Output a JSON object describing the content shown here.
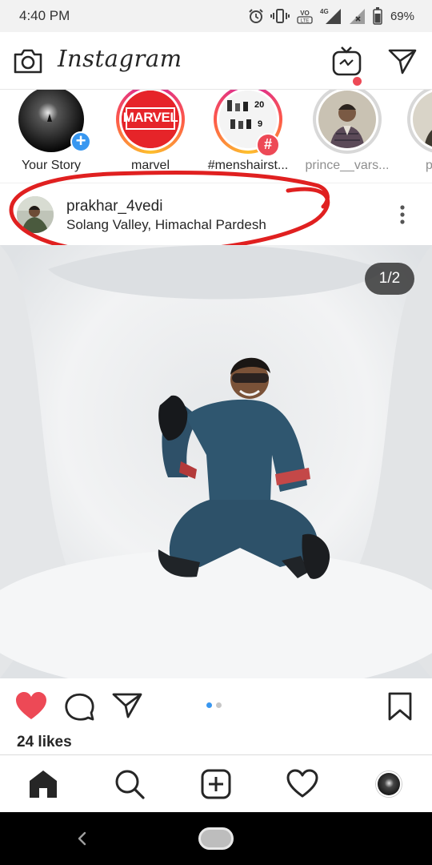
{
  "status_bar": {
    "time": "4:40 PM",
    "battery": "69%",
    "network_label": "4G",
    "volte_label": "VoLTE",
    "icons": [
      "alarm-icon",
      "vibrate-icon",
      "volte-icon",
      "signal-4g-icon",
      "signal-no-service-icon",
      "battery-icon"
    ]
  },
  "header": {
    "brand": "Instagram",
    "camera_icon": "camera-icon",
    "igtv_icon": "igtv-icon",
    "direct_icon": "direct-message-icon",
    "notification_color": "#ed4956"
  },
  "stories": [
    {
      "label": "Your Story",
      "ring": "none",
      "badge": "+"
    },
    {
      "label": "marvel",
      "ring": "gradient",
      "image_text": "MARVEL"
    },
    {
      "label": "#menshairst...",
      "ring": "gradient",
      "badge": "#",
      "image_text_1": "20",
      "image_text_2": "9"
    },
    {
      "label": "prince__vars...",
      "ring": "grey"
    },
    {
      "label": "prakh",
      "ring": "grey"
    }
  ],
  "post": {
    "username": "prakhar_4vedi",
    "location": "Solang Valley, Himachal Pardesh",
    "photo_counter": "1/2",
    "likes": "24 likes",
    "carousel_position": 1,
    "carousel_count": 2,
    "liked": true,
    "like_color": "#ed4956",
    "annotation_color": "#e02020"
  },
  "bottom_nav": {
    "items": [
      "home-icon",
      "search-icon",
      "new-post-icon",
      "activity-icon",
      "profile-avatar"
    ]
  },
  "colors": {
    "accent_blue": "#3897f0",
    "text": "#262626"
  }
}
